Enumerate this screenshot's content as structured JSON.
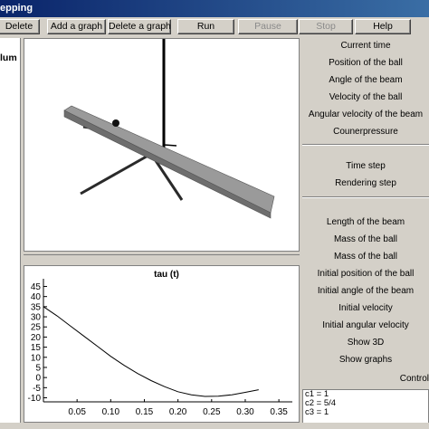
{
  "window": {
    "title": "epping"
  },
  "toolbar": {
    "buttons": [
      {
        "label": "Delete",
        "enabled": true
      },
      {
        "label": "Add a graph",
        "enabled": true
      },
      {
        "label": "Delete a graph",
        "enabled": true
      },
      {
        "label": "Run",
        "enabled": true
      },
      {
        "label": "Pause",
        "enabled": false
      },
      {
        "label": "Stop",
        "enabled": false
      },
      {
        "label": "Help",
        "enabled": true
      }
    ]
  },
  "left_panel": {
    "label": "lum"
  },
  "output_buttons": [
    "Current time",
    "Position of the ball",
    "Angle of the beam",
    "Velocity of the ball",
    "Angular velocity of the beam",
    "Counerpressure"
  ],
  "step_buttons": [
    "Time step",
    "Rendering step"
  ],
  "param_buttons": [
    "Length of the beam",
    "Mass of the ball",
    "Mass of the ball",
    "Initial position of the ball",
    "Initial angle of the beam",
    "Initial velocity",
    "Initial angular velocity",
    "Show 3D",
    "Show graphs"
  ],
  "controls_label": "Control",
  "code_lines": [
    "c1 = 1",
    "c2 = 5/4",
    "c3 = 1"
  ],
  "colors": {
    "beam": "#9a9a9a",
    "curve": "#000000",
    "title_bar": "#0a246a"
  },
  "chart_data": {
    "type": "line",
    "title": "tau (t)",
    "xlabel": "",
    "ylabel": "",
    "xticks": [
      "0.05",
      "0.10",
      "0.15",
      "0.20",
      "0.25",
      "0.30",
      "0.35"
    ],
    "yticks": [
      "45",
      "40",
      "35",
      "30",
      "25",
      "20",
      "15",
      "10",
      "5",
      "0",
      "-5",
      "-10"
    ],
    "xlim": [
      0,
      0.37
    ],
    "ylim": [
      -12,
      47
    ],
    "grid": false,
    "series": [
      {
        "x": [
          0.0,
          0.02,
          0.04,
          0.06,
          0.08,
          0.1,
          0.12,
          0.14,
          0.16,
          0.18,
          0.2,
          0.22,
          0.24,
          0.26,
          0.28,
          0.3,
          0.32
        ],
        "values": [
          35,
          30.5,
          25.5,
          20.5,
          15.5,
          10.5,
          6,
          2,
          -1.5,
          -4.5,
          -7,
          -8.5,
          -9.3,
          -9.2,
          -8.5,
          -7.3,
          -6
        ]
      }
    ]
  }
}
